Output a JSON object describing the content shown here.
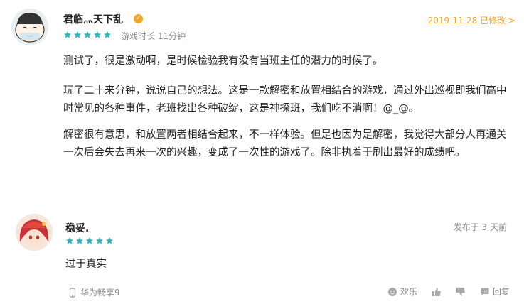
{
  "review1": {
    "username": "君临灬天下乱",
    "badge_icon": "verified-badge-icon",
    "stars": 5,
    "playtime_label": "游戏时长 11分钟",
    "edited_label": "2019-11-28 已修改 >",
    "paragraphs": [
      "测试了，很是激动啊，是时候检验我有没有当班主任的潜力的时候了。",
      "玩了二十来分钟，说说自己的想法。这是一款解密和放置相结合的游戏，通过外出巡视即我们高中时常见的各种事件，老班找出各种破绽，这是神探班，我们吃不消啊！@_@。",
      "解密很有意思，和放置两者相结合起来，不一样体验。但是也因为是解密，我觉得大部分人再通关一次后会失去再来一次的兴趣，变成了一次性的游戏了。除非执着于刷出最好的成绩吧。"
    ]
  },
  "review2": {
    "username": "稳妥.",
    "stars": 5,
    "posted_label": "发布于 3 天前",
    "comment": "过于真实"
  },
  "footer": {
    "device": "华为畅享9",
    "fun_label": "欢乐",
    "reply_label": "回复"
  },
  "colors": {
    "star": "#2bb3c0",
    "accent": "#f5a623",
    "muted": "#888888"
  }
}
